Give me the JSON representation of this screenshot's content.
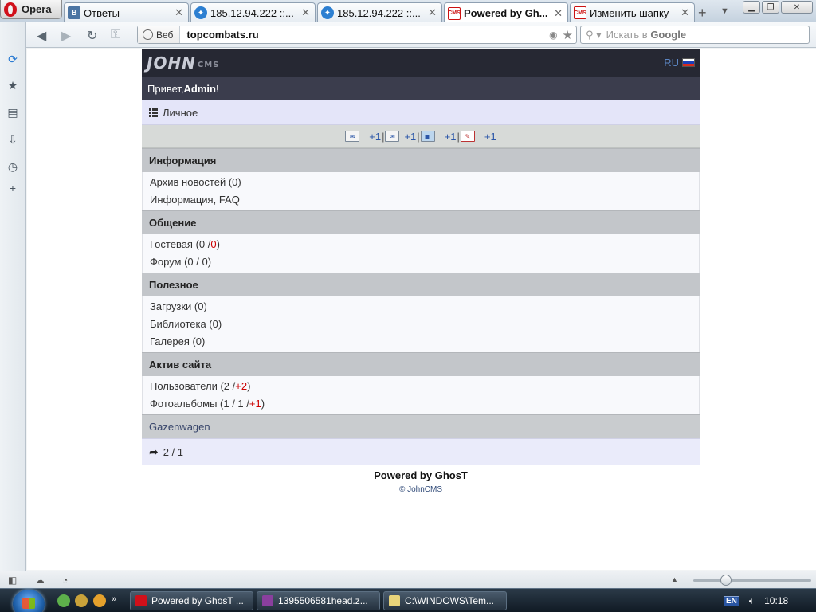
{
  "browser": {
    "menu_label": "Opera",
    "tabs": [
      {
        "label": "Ответы",
        "icon": "vk-icon"
      },
      {
        "label": "185.12.94.222 ::...",
        "icon": "globe-net-icon"
      },
      {
        "label": "185.12.94.222 ::...",
        "icon": "globe-net-icon"
      },
      {
        "label": "Powered by Gh...",
        "icon": "johncms-icon",
        "active": true
      },
      {
        "label": "Изменить шапку",
        "icon": "johncms-icon"
      }
    ],
    "address": {
      "web_label": "Веб",
      "url": "topcombats.ru"
    },
    "search": {
      "placeholder": "Искать в",
      "engine": "Google"
    }
  },
  "site": {
    "logo_main": "JOHN",
    "logo_sub": "CMS",
    "lang_label": "RU",
    "flag_colors": [
      "#ffffff",
      "#1c3fb8",
      "#d52b1e"
    ],
    "greeting_prefix": "Привет, ",
    "user_name": "Admin",
    "greeting_suffix": "!",
    "personal_label": "Личное",
    "notifications": [
      "+1",
      "+1",
      "+1",
      "+1"
    ],
    "sections": [
      {
        "title": "Информация",
        "items": [
          {
            "text": "Архив новостей (0)"
          },
          {
            "text": "Информация, FAQ"
          }
        ]
      },
      {
        "title": "Общение",
        "items": [
          {
            "pre": "Гостевая (0 / ",
            "red": "0",
            "post": ")"
          },
          {
            "text": "Форум (0 / 0)"
          }
        ]
      },
      {
        "title": "Полезное",
        "items": [
          {
            "text": "Загрузки (0)"
          },
          {
            "text": "Библиотека (0)"
          },
          {
            "text": "Галерея (0)"
          }
        ]
      },
      {
        "title": "Актив сайта",
        "items": [
          {
            "pre": "Пользователи (2 / ",
            "red": "+2",
            "post": ")"
          },
          {
            "pre": "Фотоальбомы (1 / 1 / ",
            "red": "+1",
            "post": ")"
          }
        ]
      }
    ],
    "gazenwagen_label": "Gazenwagen",
    "online_counter": "2 / 1",
    "footer_powered": "Powered by GhosT",
    "footer_copyright": "© JohnCMS"
  },
  "taskbar": {
    "tasks": [
      {
        "label": "Powered by GhosT ...",
        "icon_color": "#d1101a"
      },
      {
        "label": "1395506581head.z...",
        "icon_color": "#8a3f9e"
      },
      {
        "label": "C:\\WINDOWS\\Tem...",
        "icon_color": "#e8d37a"
      }
    ],
    "lang": "EN",
    "clock": "10:18"
  }
}
